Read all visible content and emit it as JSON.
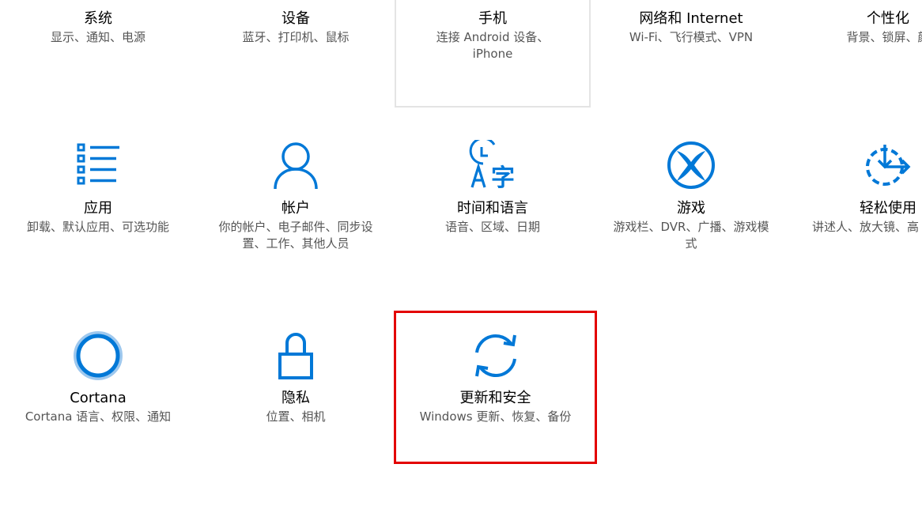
{
  "accent_color": "#0078d7",
  "highlight_color": "#e30000",
  "tiles": [
    {
      "title": "系统",
      "desc": "显示、通知、电源",
      "icon": "system-icon"
    },
    {
      "title": "设备",
      "desc": "蓝牙、打印机、鼠标",
      "icon": "devices-icon"
    },
    {
      "title": "手机",
      "desc": "连接 Android 设备、iPhone",
      "icon": "phone-icon"
    },
    {
      "title": "网络和 Internet",
      "desc": "Wi-Fi、飞行模式、VPN",
      "icon": "network-icon"
    },
    {
      "title": "个性化",
      "desc": "背景、锁屏、颜",
      "icon": "personalization-icon"
    },
    {
      "title": "应用",
      "desc": "卸载、默认应用、可选功能",
      "icon": "apps-list-icon"
    },
    {
      "title": "帐户",
      "desc": "你的帐户、电子邮件、同步设置、工作、其他人员",
      "icon": "person-icon"
    },
    {
      "title": "时间和语言",
      "desc": "语音、区域、日期",
      "icon": "time-language-icon"
    },
    {
      "title": "游戏",
      "desc": "游戏栏、DVR、广播、游戏模式",
      "icon": "xbox-icon"
    },
    {
      "title": "轻松使用",
      "desc": "讲述人、放大镜、高",
      "icon": "ease-of-access-icon"
    },
    {
      "title": "Cortana",
      "desc": "Cortana 语言、权限、通知",
      "icon": "cortana-icon"
    },
    {
      "title": "隐私",
      "desc": "位置、相机",
      "icon": "lock-icon"
    },
    {
      "title": "更新和安全",
      "desc": "Windows 更新、恢复、备份",
      "icon": "sync-icon"
    }
  ]
}
